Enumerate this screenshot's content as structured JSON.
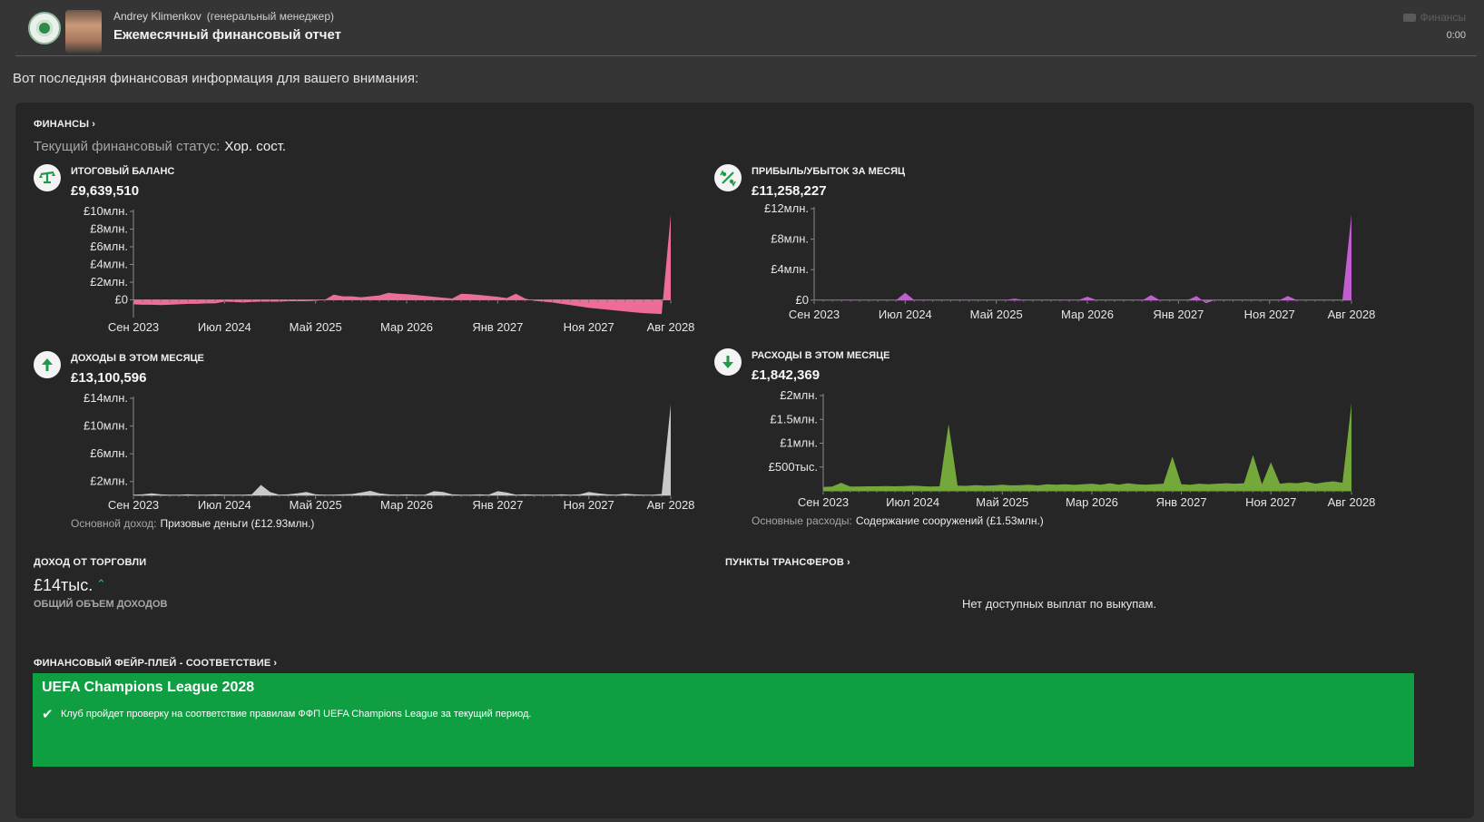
{
  "header": {
    "sender_name": "Andrey Klimenkov",
    "sender_role": "(генеральный менеджер)",
    "subject": "Ежемесячный финансовый отчет",
    "tag": "Финансы",
    "time": "0:00",
    "tag_icon": "tag-icon"
  },
  "intro": "Вот последняя финансовая информация для вашего внимания:",
  "finances": {
    "title": "ФИНАНСЫ",
    "status_label": "Текущий финансовый статус:",
    "status_value": "Хор. сост."
  },
  "cards": {
    "balance": {
      "title": "ИТОГОВЫЙ БАЛАНС",
      "value": "£9,639,510",
      "icon": "balance-scale-icon"
    },
    "profit": {
      "title": "ПРИБЫЛЬ/УБЫТОК ЗА МЕСЯЦ",
      "value": "£11,258,227",
      "icon": "percent-arrows-icon"
    },
    "income": {
      "title": "ДОХОДЫ В ЭТОМ МЕСЯЦЕ",
      "value": "£13,100,596",
      "icon": "arrow-up-icon",
      "foot_label": "Основной доход:",
      "foot_value": "Призовые деньги (£12.93млн.)"
    },
    "expenses": {
      "title": "РАСХОДЫ В ЭТОМ МЕСЯЦЕ",
      "value": "£1,842,369",
      "icon": "arrow-down-icon",
      "foot_label": "Основные расходы:",
      "foot_value": "Содержание сооружений (£1.53млн.)"
    }
  },
  "trade": {
    "title": "ДОХОД ОТ ТОРГОВЛИ",
    "amount": "£14тыс.",
    "trend_icon": "trend-up-icon",
    "caption": "ОБЩИЙ ОБЪЕМ ДОХОДОВ"
  },
  "transfers": {
    "title": "ПУНКТЫ ТРАНСФЕРОВ",
    "empty_text": "Нет доступных выплат по выкупам."
  },
  "ffp": {
    "title": "ФИНАНСОВЫЙ ФЕЙР-ПЛЕЙ - СООТВЕТСТВИЕ",
    "competition": "UEFA Champions League 2028",
    "check_icon": "checkmark-icon",
    "message": "Клуб пройдет проверку на соответствие правилам ФФП UEFA Champions League за текущий период."
  },
  "colors": {
    "balance": "#ee6c9a",
    "profit": "#c15fd0",
    "income": "#c9c9c9",
    "expenses": "#74a83a",
    "ffp_ok": "#0f9f42",
    "icon_green": "#1e9a4a"
  },
  "chart_data": [
    {
      "type": "area",
      "title": "ИТОГОВЫЙ БАЛАНС",
      "x_ticks": [
        "Сен 2023",
        "Июл 2024",
        "Май 2025",
        "Мар 2026",
        "Янв 2027",
        "Ноя 2027",
        "Авг 2028"
      ],
      "y_ticks": [
        "£10млн.",
        "£8млн.",
        "£6млн.",
        "£4млн.",
        "£2млн.",
        "£0"
      ],
      "ylim": [
        -2000000,
        10000000
      ],
      "x": [
        "Сен 2023",
        "Окт 2023",
        "Ноя 2023",
        "Дек 2023",
        "Янв 2024",
        "Фев 2024",
        "Мар 2024",
        "Апр 2024",
        "Май 2024",
        "Июн 2024",
        "Июл 2024",
        "Авг 2024",
        "Сен 2024",
        "Окт 2024",
        "Ноя 2024",
        "Дек 2024",
        "Янв 2025",
        "Фев 2025",
        "Мар 2025",
        "Апр 2025",
        "Май 2025",
        "Июн 2025",
        "Июл 2025",
        "Авг 2025",
        "Сен 2025",
        "Окт 2025",
        "Ноя 2025",
        "Дек 2025",
        "Янв 2026",
        "Фев 2026",
        "Мар 2026",
        "Апр 2026",
        "Май 2026",
        "Июн 2026",
        "Июл 2026",
        "Авг 2026",
        "Сен 2026",
        "Окт 2026",
        "Ноя 2026",
        "Дек 2026",
        "Янв 2027",
        "Фев 2027",
        "Мар 2027",
        "Апр 2027",
        "Май 2027",
        "Июн 2027",
        "Июл 2027",
        "Авг 2027",
        "Сен 2027",
        "Окт 2027",
        "Ноя 2027",
        "Дек 2027",
        "Янв 2028",
        "Фев 2028",
        "Мар 2028",
        "Апр 2028",
        "Май 2028",
        "Июн 2028",
        "Июл 2028",
        "Авг 2028"
      ],
      "y": [
        -500000,
        -550000,
        -550000,
        -600000,
        -550000,
        -500000,
        -450000,
        -450000,
        -400000,
        -400000,
        -200000,
        -250000,
        -300000,
        -250000,
        -200000,
        -200000,
        -200000,
        -150000,
        -150000,
        -150000,
        -100000,
        0,
        600000,
        400000,
        400000,
        300000,
        400000,
        500000,
        800000,
        700000,
        650000,
        550000,
        450000,
        350000,
        250000,
        150000,
        700000,
        650000,
        550000,
        450000,
        350000,
        200000,
        700000,
        150000,
        -100000,
        -200000,
        -300000,
        -450000,
        -600000,
        -750000,
        -900000,
        -1000000,
        -1100000,
        -1200000,
        -1300000,
        -1400000,
        -1500000,
        -1550000,
        -1600000,
        9639510
      ]
    },
    {
      "type": "area",
      "title": "ПРИБЫЛЬ/УБЫТОК ЗА МЕСЯЦ",
      "x_ticks": [
        "Сен 2023",
        "Июл 2024",
        "Май 2025",
        "Мар 2026",
        "Янв 2027",
        "Ноя 2027",
        "Авг 2028"
      ],
      "y_ticks": [
        "£12млн.",
        "£8млн.",
        "£4млн.",
        "£0"
      ],
      "ylim": [
        -500000,
        12000000
      ],
      "x": [
        "Сен 2023",
        "Окт 2023",
        "Ноя 2023",
        "Дек 2023",
        "Янв 2024",
        "Фев 2024",
        "Мар 2024",
        "Апр 2024",
        "Май 2024",
        "Июн 2024",
        "Июл 2024",
        "Авг 2024",
        "Сен 2024",
        "Окт 2024",
        "Ноя 2024",
        "Дек 2024",
        "Янв 2025",
        "Фев 2025",
        "Мар 2025",
        "Апр 2025",
        "Май 2025",
        "Июн 2025",
        "Июл 2025",
        "Авг 2025",
        "Сен 2025",
        "Окт 2025",
        "Ноя 2025",
        "Дек 2025",
        "Янв 2026",
        "Фев 2026",
        "Мар 2026",
        "Апр 2026",
        "Май 2026",
        "Июн 2026",
        "Июл 2026",
        "Авг 2026",
        "Сен 2026",
        "Окт 2026",
        "Ноя 2026",
        "Дек 2026",
        "Янв 2027",
        "Фев 2027",
        "Мар 2027",
        "Апр 2027",
        "Май 2027",
        "Июн 2027",
        "Июл 2027",
        "Авг 2027",
        "Сен 2027",
        "Окт 2027",
        "Ноя 2027",
        "Дек 2027",
        "Янв 2028",
        "Фев 2028",
        "Мар 2028",
        "Апр 2028",
        "Май 2028",
        "Июн 2028",
        "Июл 2028",
        "Авг 2028"
      ],
      "y": [
        0,
        0,
        0,
        0,
        -50000,
        0,
        0,
        0,
        0,
        0,
        950000,
        0,
        -50000,
        0,
        0,
        0,
        -50000,
        0,
        0,
        0,
        0,
        0,
        200000,
        0,
        0,
        0,
        0,
        0,
        -50000,
        0,
        450000,
        0,
        0,
        0,
        0,
        0,
        -50000,
        650000,
        -50000,
        0,
        0,
        0,
        550000,
        -400000,
        0,
        0,
        0,
        0,
        0,
        0,
        0,
        -50000,
        550000,
        0,
        0,
        0,
        0,
        0,
        0,
        11258227
      ]
    },
    {
      "type": "area",
      "title": "ДОХОДЫ В ЭТОМ МЕСЯЦЕ",
      "x_ticks": [
        "Сен 2023",
        "Июл 2024",
        "Май 2025",
        "Мар 2026",
        "Янв 2027",
        "Ноя 2027",
        "Авг 2028"
      ],
      "y_ticks": [
        "£14млн.",
        "£10млн.",
        "£6млн.",
        "£2млн."
      ],
      "ylim": [
        0,
        14000000
      ],
      "x": [
        "Сен 2023",
        "Окт 2023",
        "Ноя 2023",
        "Дек 2023",
        "Янв 2024",
        "Фев 2024",
        "Мар 2024",
        "Апр 2024",
        "Май 2024",
        "Июн 2024",
        "Июл 2024",
        "Авг 2024",
        "Сен 2024",
        "Окт 2024",
        "Ноя 2024",
        "Дек 2024",
        "Янв 2025",
        "Фев 2025",
        "Мар 2025",
        "Апр 2025",
        "Май 2025",
        "Июн 2025",
        "Июл 2025",
        "Авг 2025",
        "Сен 2025",
        "Окт 2025",
        "Ноя 2025",
        "Дек 2025",
        "Янв 2026",
        "Фев 2026",
        "Мар 2026",
        "Апр 2026",
        "Май 2026",
        "Июн 2026",
        "Июл 2026",
        "Авг 2026",
        "Сен 2026",
        "Окт 2026",
        "Ноя 2026",
        "Дек 2026",
        "Янв 2027",
        "Фев 2027",
        "Мар 2027",
        "Апр 2027",
        "Май 2027",
        "Июн 2027",
        "Июл 2027",
        "Авг 2027",
        "Сен 2027",
        "Окт 2027",
        "Ноя 2027",
        "Дек 2027",
        "Янв 2028",
        "Фев 2028",
        "Мар 2028",
        "Апр 2028",
        "Май 2028",
        "Июн 2028",
        "Июл 2028",
        "Авг 2028"
      ],
      "y": [
        100000,
        150000,
        300000,
        150000,
        100000,
        100000,
        150000,
        100000,
        100000,
        150000,
        100000,
        100000,
        100000,
        150000,
        1500000,
        500000,
        100000,
        150000,
        300000,
        500000,
        150000,
        100000,
        100000,
        150000,
        200000,
        400000,
        650000,
        300000,
        150000,
        100000,
        150000,
        100000,
        100000,
        600000,
        500000,
        150000,
        100000,
        100000,
        150000,
        100000,
        600000,
        400000,
        100000,
        150000,
        100000,
        100000,
        100000,
        150000,
        100000,
        150000,
        500000,
        300000,
        150000,
        100000,
        250000,
        150000,
        100000,
        100000,
        200000,
        13100596
      ]
    },
    {
      "type": "area",
      "title": "РАСХОДЫ В ЭТОМ МЕСЯЦЕ",
      "x_ticks": [
        "Сен 2023",
        "Июл 2024",
        "Май 2025",
        "Мар 2026",
        "Янв 2027",
        "Ноя 2027",
        "Авг 2028"
      ],
      "y_ticks": [
        "£2млн.",
        "£1.5млн.",
        "£1млн.",
        "£500тыс."
      ],
      "ylim": [
        0,
        2000000
      ],
      "x": [
        "Сен 2023",
        "Окт 2023",
        "Ноя 2023",
        "Дек 2023",
        "Янв 2024",
        "Фев 2024",
        "Мар 2024",
        "Апр 2024",
        "Май 2024",
        "Июн 2024",
        "Июл 2024",
        "Авг 2024",
        "Сен 2024",
        "Окт 2024",
        "Ноя 2024",
        "Дек 2024",
        "Янв 2025",
        "Фев 2025",
        "Мар 2025",
        "Апр 2025",
        "Май 2025",
        "Июн 2025",
        "Июл 2025",
        "Авг 2025",
        "Сен 2025",
        "Окт 2025",
        "Ноя 2025",
        "Дек 2025",
        "Янв 2026",
        "Фев 2026",
        "Мар 2026",
        "Апр 2026",
        "Май 2026",
        "Июн 2026",
        "Июл 2026",
        "Авг 2026",
        "Сен 2026",
        "Окт 2026",
        "Ноя 2026",
        "Дек 2026",
        "Янв 2027",
        "Фев 2027",
        "Мар 2027",
        "Апр 2027",
        "Май 2027",
        "Июн 2027",
        "Июл 2027",
        "Авг 2027",
        "Сен 2027",
        "Окт 2027",
        "Ноя 2027",
        "Дек 2027",
        "Янв 2028",
        "Фев 2028",
        "Мар 2028",
        "Апр 2028",
        "Май 2028",
        "Июн 2028",
        "Июл 2028",
        "Авг 2028"
      ],
      "y": [
        80000,
        90000,
        170000,
        90000,
        90000,
        95000,
        95000,
        100000,
        95000,
        100000,
        110000,
        100000,
        90000,
        95000,
        1400000,
        110000,
        105000,
        120000,
        110000,
        115000,
        130000,
        115000,
        120000,
        130000,
        115000,
        140000,
        130000,
        140000,
        125000,
        140000,
        150000,
        130000,
        160000,
        130000,
        160000,
        140000,
        130000,
        140000,
        150000,
        720000,
        140000,
        130000,
        150000,
        140000,
        150000,
        160000,
        150000,
        160000,
        750000,
        140000,
        600000,
        150000,
        170000,
        160000,
        190000,
        150000,
        180000,
        200000,
        170000,
        1842369
      ]
    }
  ]
}
